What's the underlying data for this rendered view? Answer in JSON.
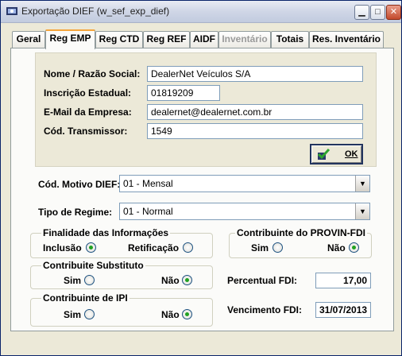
{
  "window": {
    "title": "Exportação DIEF (w_sef_exp_dief)"
  },
  "tabs": [
    {
      "label": "Geral"
    },
    {
      "label": "Reg EMP"
    },
    {
      "label": "Reg CTD"
    },
    {
      "label": "Reg REF"
    },
    {
      "label": "AIDF"
    },
    {
      "label": "Inventário"
    },
    {
      "label": "Totais"
    },
    {
      "label": "Res. Inventário"
    }
  ],
  "company": {
    "name_label": "Nome / Razão Social:",
    "name_value": "DealerNet Veículos S/A",
    "state_reg_label": "Inscrição Estadual:",
    "state_reg_value": "01819209",
    "email_label": "E-Mail da Empresa:",
    "email_value": "dealernet@dealernet.com.br",
    "transmitter_label": "Cód. Transmissor:",
    "transmitter_value": "1549",
    "ok_label": "OK"
  },
  "motivo": {
    "label": "Cód. Motivo DIEF:",
    "value": "01 - Mensal"
  },
  "regime": {
    "label": "Tipo de Regime:",
    "value": "01 - Normal"
  },
  "finalidade": {
    "title": "Finalidade das Informações",
    "opt1": "Inclusão",
    "opt2": "Retificação"
  },
  "provin": {
    "title": "Contribuinte do PROVIN-FDI",
    "yes": "Sim",
    "no": "Não"
  },
  "substituto": {
    "title": "Contribuite Substituto",
    "yes": "Sim",
    "no": "Não"
  },
  "ipi": {
    "title": "Contribuinte de IPI",
    "yes": "Sim",
    "no": "Não"
  },
  "fdi": {
    "percent_label": "Percentual FDI:",
    "percent_value": "17,00",
    "due_label": "Vencimento FDI:",
    "due_value": "31/07/2013"
  }
}
